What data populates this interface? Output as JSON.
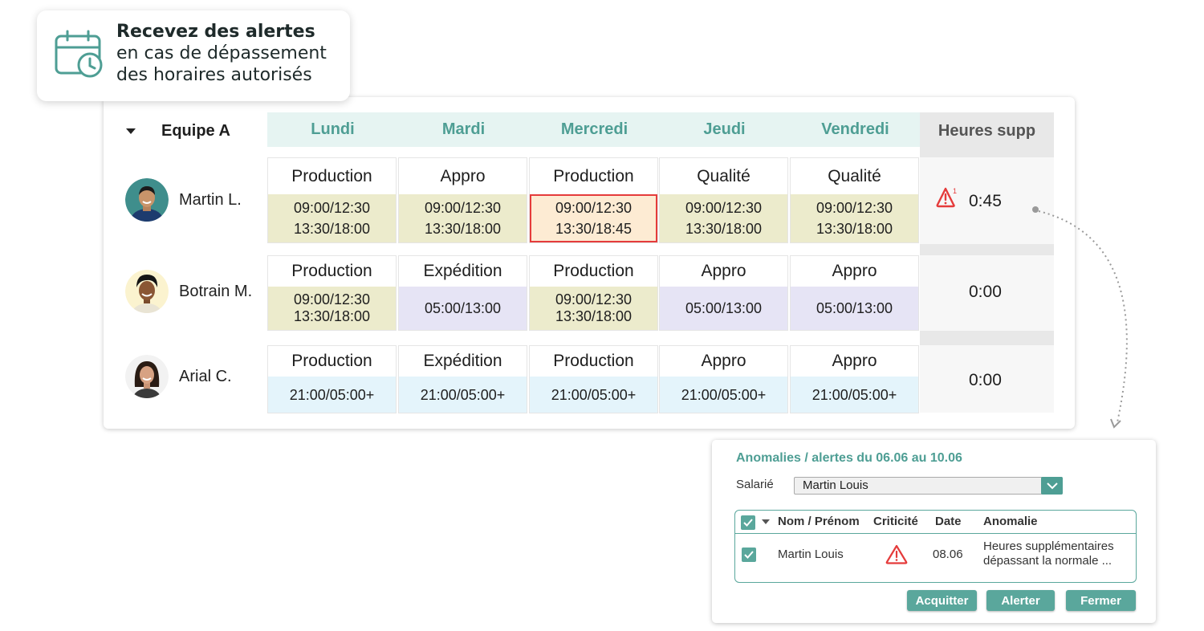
{
  "callout": {
    "bold": "Recevez des alertes",
    "rest": " en cas de dépassement des horaires autorisés",
    "icon": "calendar-clock-icon"
  },
  "planning": {
    "team": "Equipe A",
    "days": [
      "Lundi",
      "Mardi",
      "Mercredi",
      "Jeudi",
      "Vendredi"
    ],
    "overtime_header": "Heures supp",
    "employees": [
      {
        "name": "Martin L.",
        "overtime": "0:45",
        "overtime_alert": true,
        "alert_superscript": "1",
        "shifts": [
          {
            "role": "Production",
            "line1": "09:00/12:30",
            "line2": "13:30/18:00",
            "style": "olive"
          },
          {
            "role": "Appro",
            "line1": "09:00/12:30",
            "line2": "13:30/18:00",
            "style": "olive"
          },
          {
            "role": "Production",
            "line1": "09:00/12:30",
            "line2": "13:30/18:45",
            "style": "alert"
          },
          {
            "role": "Qualité",
            "line1": "09:00/12:30",
            "line2": "13:30/18:00",
            "style": "olive"
          },
          {
            "role": "Qualité",
            "line1": "09:00/12:30",
            "line2": "13:30/18:00",
            "style": "olive"
          }
        ]
      },
      {
        "name": "Botrain M.",
        "overtime": "0:00",
        "shifts": [
          {
            "role": "Production",
            "line1": "09:00/12:30",
            "line2": "13:30/18:00",
            "style": "olive"
          },
          {
            "role": "Expédition",
            "line1": "05:00/13:00",
            "line2": "",
            "style": "lav"
          },
          {
            "role": "Production",
            "line1": "09:00/12:30",
            "line2": "13:30/18:00",
            "style": "olive"
          },
          {
            "role": "Appro",
            "line1": "05:00/13:00",
            "line2": "",
            "style": "lav"
          },
          {
            "role": "Appro",
            "line1": "05:00/13:00",
            "line2": "",
            "style": "lav"
          }
        ]
      },
      {
        "name": "Arial C.",
        "overtime": "0:00",
        "shifts": [
          {
            "role": "Production",
            "line1": "21:00/05:00+",
            "line2": "",
            "style": "blue"
          },
          {
            "role": "Expédition",
            "line1": "21:00/05:00+",
            "line2": "",
            "style": "blue"
          },
          {
            "role": "Production",
            "line1": "21:00/05:00+",
            "line2": "",
            "style": "blue"
          },
          {
            "role": "Appro",
            "line1": "21:00/05:00+",
            "line2": "",
            "style": "blue"
          },
          {
            "role": "Appro",
            "line1": "21:00/05:00+",
            "line2": "",
            "style": "blue"
          }
        ]
      }
    ]
  },
  "dialog": {
    "title": "Anomalies / alertes du 06.06 au 10.06",
    "employee_label": "Salarié",
    "employee_value": "Martin Louis",
    "columns": [
      "Nom / Prénom",
      "Criticité",
      "Date",
      "Anomalie"
    ],
    "row": {
      "name": "Martin Louis",
      "criticity_icon": "warning-triangle-icon",
      "date": "08.06",
      "anomaly_line1": "Heures supplémentaires",
      "anomaly_line2": "dépassant la normale ..."
    },
    "buttons": {
      "acknowledge": "Acquitter",
      "alert": "Alerter",
      "close": "Fermer"
    }
  },
  "colors": {
    "teal": "#4e9e94",
    "alert_red": "#e53b3b",
    "olive": "#ecebcc",
    "lavender": "#e6e4f5",
    "light_blue": "#e4f4fb"
  }
}
